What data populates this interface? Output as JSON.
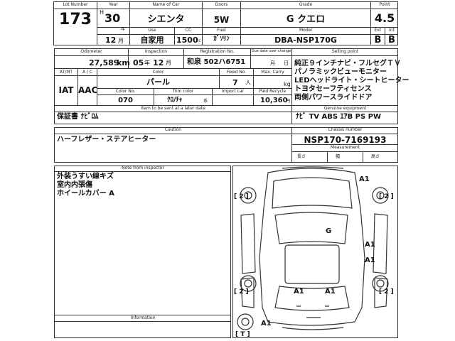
{
  "header": {
    "lot_number_caption": "Lot Number",
    "lot_number": "173",
    "year_caption": "Year",
    "year_prefix": "H",
    "year_value": "30",
    "year_unit": "年",
    "month_value": "12",
    "month_unit": "月",
    "name_caption": "Name of Car",
    "name": "シエンタ",
    "use_caption": "Use",
    "use": "自家用",
    "doors_caption": "Doors",
    "doors": "5W",
    "cc_caption": "CC",
    "cc_value": "1500",
    "cc_unit": "cc",
    "fuel_caption": "Fuel",
    "fuel": "ｶﾞｿﾘﾝ",
    "grade_caption": "Grade",
    "grade": "G クエロ",
    "model_caption": "Model",
    "model": "DBA-NSP170G",
    "point_caption": "Point",
    "point": "4.5",
    "ext_caption": "Ext",
    "ext": "B",
    "int_caption": "Int",
    "int": "B"
  },
  "row2": {
    "odometer_caption": "Odometer",
    "odometer": "27,589",
    "odometer_unit": "km",
    "inspection_caption": "Inspection",
    "inspection_year": "05",
    "inspection_year_unit": "年",
    "inspection_month": "12",
    "inspection_month_unit": "月",
    "registration_caption": "Registration No.",
    "registration": "和泉 502ハ6751",
    "due_date_caption": "Due date user change",
    "due_date_unit": "月 日",
    "atmt_caption": "AT/MT",
    "atmt": "IAT",
    "ac_caption": "A / C",
    "ac": "AAC",
    "color_caption": "Color",
    "color": "パール",
    "fixed_caption": "Fixed No.",
    "fixed": "7",
    "fixed_unit": "人",
    "max_carry_caption": "Max. Carry",
    "max_carry_unit": "kg",
    "color_no_caption": "Color No.",
    "color_no": "070",
    "trim_caption": "Trim color",
    "trim": "ｸﾛ/ﾁｬ",
    "trim_unit": "系",
    "import_caption": "Import car",
    "recycle_caption": "Paid Recycle",
    "recycle": "10,360",
    "recycle_unit": "円",
    "sent_caption": "Item to be sent at a later date",
    "sent": "保証書 ﾅﾋﾞﾛﾑ"
  },
  "selling": {
    "caption": "Selling point",
    "lines": [
      "純正９インチナビ・フルセグＴＶ",
      "パノラミックビューモニター",
      "LEDヘッドライト・シートヒーター",
      "トヨタセーフティセンス",
      "両側パワースライドドア"
    ]
  },
  "equipment": {
    "caption": "Genuine equipment",
    "value": "ﾅﾋﾞ TV ABS ｴｱB PS PW"
  },
  "caution": {
    "caption": "Caution",
    "text": "ハーフレザー・ステアヒーター"
  },
  "chassis": {
    "caption": "Chassis number",
    "value": "NSP170-7169193"
  },
  "measurement": {
    "caption": "Measurement",
    "length_label": "長さ",
    "width_label": "幅",
    "height_label": "高さ"
  },
  "inspector": {
    "caption": "Note from inspector",
    "lines": [
      "外装うすい線キズ",
      "室内内張傷",
      "ホイールカバー A"
    ]
  },
  "information": {
    "caption": "Information"
  },
  "diagram": {
    "marks": [
      "A1",
      "G",
      "A1",
      "A1",
      "A1",
      "A1",
      "A1"
    ],
    "brackets": [
      "[ 2 ]",
      "[ 2 ]",
      "[ 2 ]",
      "[ 2 ]",
      "[ T ]"
    ]
  }
}
